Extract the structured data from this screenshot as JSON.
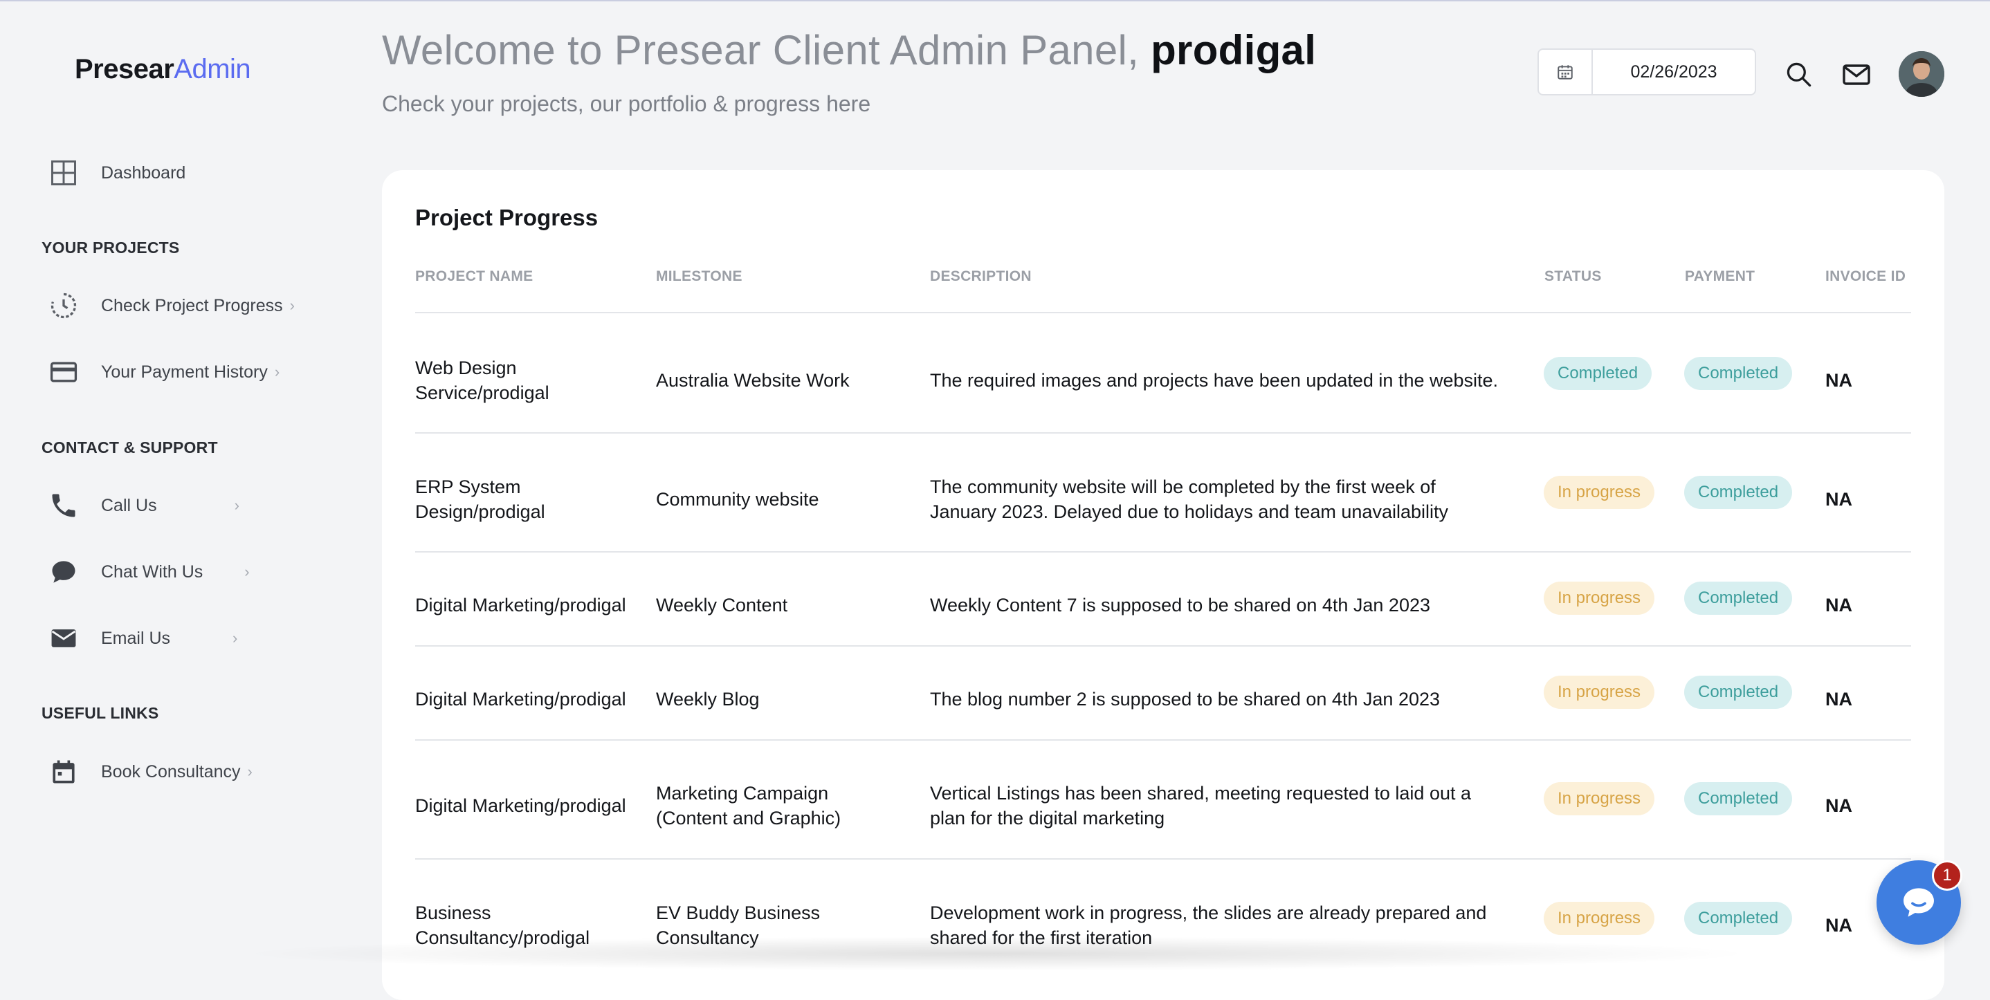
{
  "brand": {
    "part1": "Presear",
    "part2": "Admin"
  },
  "sidebar": {
    "dashboard": "Dashboard",
    "section_projects": "YOUR PROJECTS",
    "check_progress": "Check Project Progress",
    "payment_history": "Your Payment History",
    "section_contact": "CONTACT & SUPPORT",
    "call_us": "Call Us",
    "chat_with_us": "Chat With Us",
    "email_us": "Email Us",
    "section_links": "USEFUL LINKS",
    "book_consultancy": "Book Consultancy",
    "chevron": "›"
  },
  "header": {
    "welcome_prefix": "Welcome to Presear Client Admin Panel, ",
    "username": "prodigal",
    "subtitle": "Check your projects, our portfolio & progress here",
    "date": "02/26/2023"
  },
  "table": {
    "title": "Project Progress",
    "headers": {
      "project": "PROJECT NAME",
      "milestone": "MILESTONE",
      "description": "DESCRIPTION",
      "status": "STATUS",
      "payment": "PAYMENT",
      "invoice": "INVOICE ID"
    },
    "rows": [
      {
        "project": [
          "Web Design",
          "Service/prodigal"
        ],
        "milestone": [
          "Australia Website Work"
        ],
        "description": [
          "The required images and projects have been updated in the website."
        ],
        "status": "Completed",
        "payment": "Completed",
        "invoice": "NA"
      },
      {
        "project": [
          "ERP System",
          "Design/prodigal"
        ],
        "milestone": [
          "Community website"
        ],
        "description": [
          "The community website will be completed by the first week of",
          "January 2023. Delayed due to holidays and team unavailability"
        ],
        "status": "In progress",
        "payment": "Completed",
        "invoice": "NA"
      },
      {
        "project": [
          "Digital Marketing/prodigal"
        ],
        "milestone": [
          "Weekly Content"
        ],
        "description": [
          "Weekly Content 7 is supposed to be shared on 4th Jan 2023"
        ],
        "status": "In progress",
        "payment": "Completed",
        "invoice": "NA"
      },
      {
        "project": [
          "Digital Marketing/prodigal"
        ],
        "milestone": [
          "Weekly Blog"
        ],
        "description": [
          "The blog number 2 is supposed to be shared on 4th Jan 2023"
        ],
        "status": "In progress",
        "payment": "Completed",
        "invoice": "NA"
      },
      {
        "project": [
          "Digital Marketing/prodigal"
        ],
        "milestone": [
          "Marketing Campaign",
          "(Content and Graphic)"
        ],
        "description": [
          "Vertical Listings has been shared, meeting requested to laid out a",
          "plan for the digital marketing"
        ],
        "status": "In progress",
        "payment": "Completed",
        "invoice": "NA"
      },
      {
        "project": [
          "Business",
          "Consultancy/prodigal"
        ],
        "milestone": [
          "EV Buddy Business",
          "Consultancy"
        ],
        "description": [
          "Development work in progress, the slides are already prepared and",
          "shared for the first iteration"
        ],
        "status": "In progress",
        "payment": "Completed",
        "invoice": "NA"
      }
    ]
  },
  "chat_widget": {
    "unread_count": "1"
  },
  "colors": {
    "accent": "#5a6bf0",
    "completed_bg": "#d7eff0",
    "completed_fg": "#3d9e9c",
    "progress_bg": "#fcf0d8",
    "progress_fg": "#d7a446",
    "chat_blue": "#3f7ee0"
  }
}
